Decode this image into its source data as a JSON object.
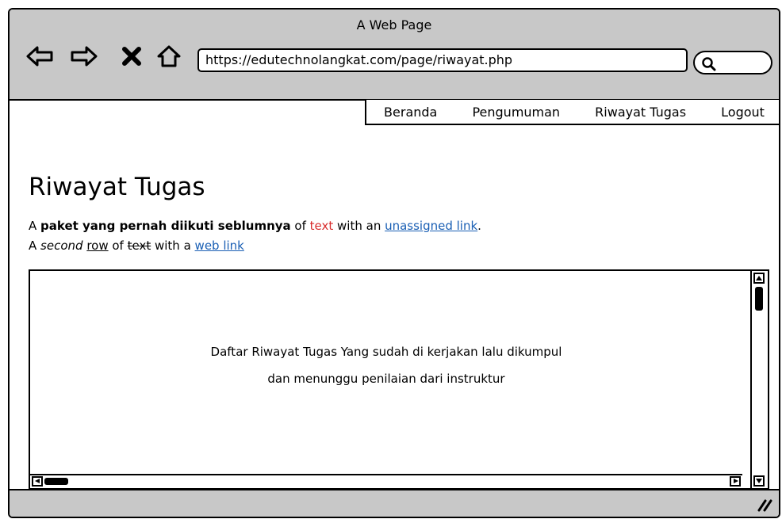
{
  "window": {
    "title": "A Web Page"
  },
  "browser": {
    "url": "https://edutechnolangkat.com/page/riwayat.php",
    "icons": [
      "back-arrow-icon",
      "forward-arrow-icon",
      "close-x-icon",
      "home-icon",
      "search-icon"
    ]
  },
  "nav": {
    "items": [
      {
        "label": "Beranda"
      },
      {
        "label": "Pengumuman"
      },
      {
        "label": "Riwayat Tugas"
      },
      {
        "label": "Logout"
      }
    ]
  },
  "page": {
    "heading": "Riwayat Tugas",
    "line1": {
      "a": "A ",
      "bold": "paket yang pernah diikuti seblumnya",
      "of": " of ",
      "red": "text",
      "with": " with an ",
      "link": "unassigned link",
      "end": "."
    },
    "line2": {
      "a": "A ",
      "italic": "second",
      "sp": " ",
      "underline": "row",
      "of": " of ",
      "strike": "text",
      "with": " with a ",
      "link": "web link"
    }
  },
  "panel": {
    "line1": "Daftar Riwayat Tugas Yang sudah di kerjakan lalu dikumpul",
    "line2": "dan menunggu penilaian dari instruktur"
  },
  "colors": {
    "chrome": "#c8c8c8",
    "link": "#1a5fb4",
    "red": "#d82b2b"
  }
}
